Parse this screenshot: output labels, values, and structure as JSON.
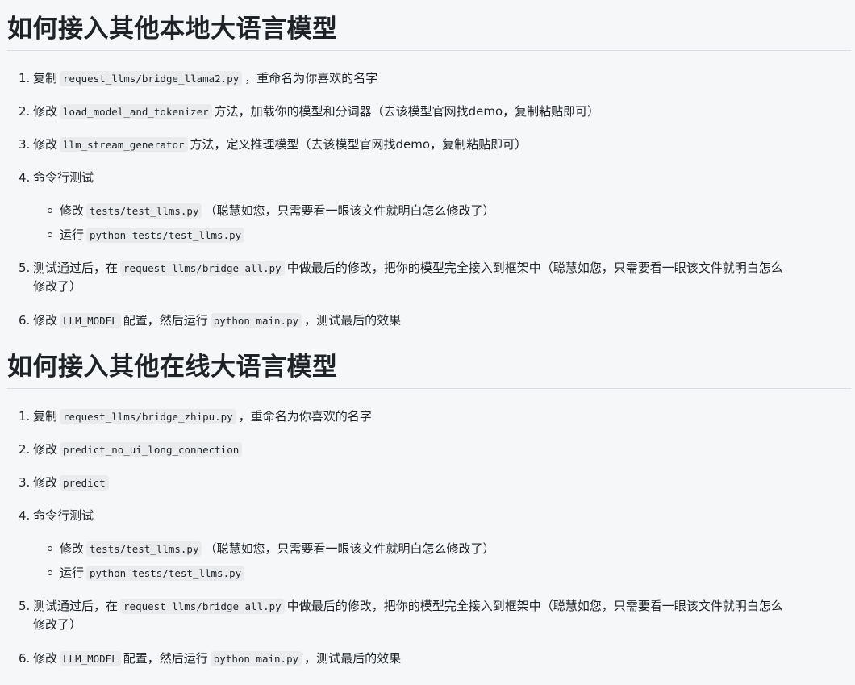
{
  "sections": [
    {
      "title": "如何接入其他本地大语言模型",
      "steps": [
        {
          "num": "1.",
          "a": "复制",
          "code1": "request_llms/bridge_llama2.py",
          "b": "，重命名为你喜欢的名字"
        },
        {
          "num": "2.",
          "a": "修改",
          "code1": "load_model_and_tokenizer",
          "b": "方法，加载你的模型和分词器（去该模型官网找demo，复制粘贴即可）"
        },
        {
          "num": "3.",
          "a": "修改",
          "code1": "llm_stream_generator",
          "b": "方法，定义推理模型（去该模型官网找demo，复制粘贴即可）"
        },
        {
          "num": "4.",
          "a": "命令行测试",
          "sub": [
            {
              "a": "修改",
              "code": "tests/test_llms.py",
              "b": "（聪慧如您，只需要看一眼该文件就明白怎么修改了）"
            },
            {
              "a": "运行",
              "code": "python tests/test_llms.py",
              "b": ""
            }
          ]
        },
        {
          "num": "5.",
          "a": "测试通过后，在",
          "code1": "request_llms/bridge_all.py",
          "b": "中做最后的修改，把你的模型完全接入到框架中（聪慧如您，只需要看一眼该文件就明白怎么",
          "c": "修改了）"
        },
        {
          "num": "6.",
          "a": "修改",
          "code1": "LLM_MODEL",
          "b": "配置，然后运行",
          "code2": "python main.py",
          "d": "，测试最后的效果"
        }
      ]
    },
    {
      "title": "如何接入其他在线大语言模型",
      "steps": [
        {
          "num": "1.",
          "a": "复制",
          "code1": "request_llms/bridge_zhipu.py",
          "b": "，重命名为你喜欢的名字"
        },
        {
          "num": "2.",
          "a": "修改",
          "code1": "predict_no_ui_long_connection",
          "b": ""
        },
        {
          "num": "3.",
          "a": "修改",
          "code1": "predict",
          "b": ""
        },
        {
          "num": "4.",
          "a": "命令行测试",
          "sub": [
            {
              "a": "修改",
              "code": "tests/test_llms.py",
              "b": "（聪慧如您，只需要看一眼该文件就明白怎么修改了）"
            },
            {
              "a": "运行",
              "code": "python tests/test_llms.py",
              "b": ""
            }
          ]
        },
        {
          "num": "5.",
          "a": "测试通过后，在",
          "code1": "request_llms/bridge_all.py",
          "b": "中做最后的修改，把你的模型完全接入到框架中（聪慧如您，只需要看一眼该文件就明白怎么",
          "c": "修改了）"
        },
        {
          "num": "6.",
          "a": "修改",
          "code1": "LLM_MODEL",
          "b": "配置，然后运行",
          "code2": "python main.py",
          "d": "，测试最后的效果"
        }
      ]
    }
  ]
}
